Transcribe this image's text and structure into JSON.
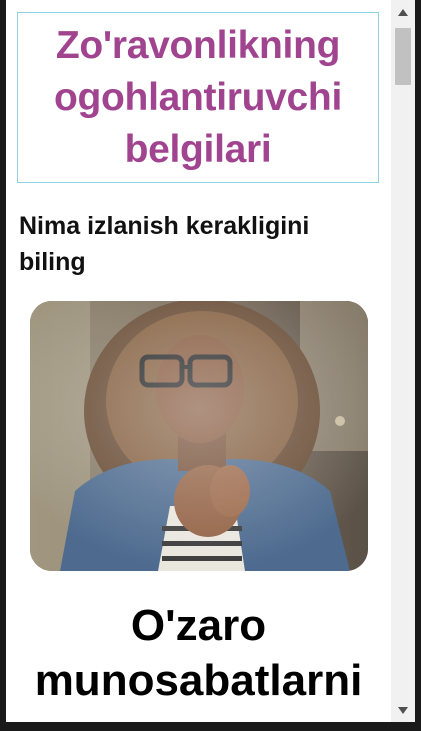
{
  "header": {
    "title": "Zo'ravonlikning ogohlantiruvchi belgilari"
  },
  "section": {
    "subheading": "Nima izlanish kerakligini biling",
    "image_alt": "woman-looking-through-window",
    "big_heading": "O'zaro munosabatlarni"
  },
  "scrollbar": {
    "up_icon": "triangle-up-icon",
    "down_icon": "triangle-down-icon"
  },
  "colors": {
    "title": "#a1448f",
    "title_border": "#8fd3e0",
    "text": "#111111",
    "scrollbar_track": "#f1f1f1",
    "scrollbar_thumb": "#c1c1c1"
  }
}
